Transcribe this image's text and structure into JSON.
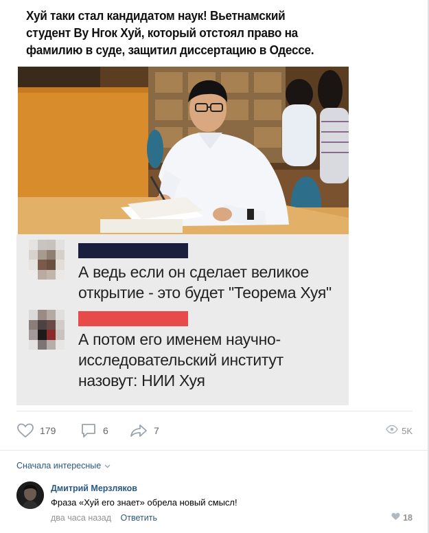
{
  "post": {
    "headline": "Хуй таки стал кандидатом наук! Вьетнамский\nстудент Ву Нгок Хуй, который отстоял право на\nфамилию в суде, защитил диссертацию в Одессе.",
    "meme_comments": [
      {
        "name_bar_color": "#1a1f3d",
        "text": "А ведь если он сделает великое\nоткрытие - это будет \"Теорема Хуя\""
      },
      {
        "name_bar_color": "#e84a4a",
        "text": "А потом его именем научно-\nисследовательский институт\nназовут: НИИ Хуя"
      }
    ]
  },
  "actions": {
    "likes": "179",
    "comments": "6",
    "shares": "7",
    "views": "5K",
    "icons": {
      "like": "heart-icon",
      "comment": "comment-icon",
      "share": "share-arrow-icon",
      "views": "eye-icon"
    }
  },
  "comments_section": {
    "sort_label": "Сначала интересные",
    "comment": {
      "author": "Дмитрий Мерзляков",
      "text": "Фраза «Хуй его знает» обрела новый смысл!",
      "time": "два часа назад",
      "reply_label": "Ответить",
      "likes": "18"
    }
  },
  "colors": {
    "link": "#2a5885",
    "muted": "#939393",
    "icon": "#99a2ad"
  }
}
